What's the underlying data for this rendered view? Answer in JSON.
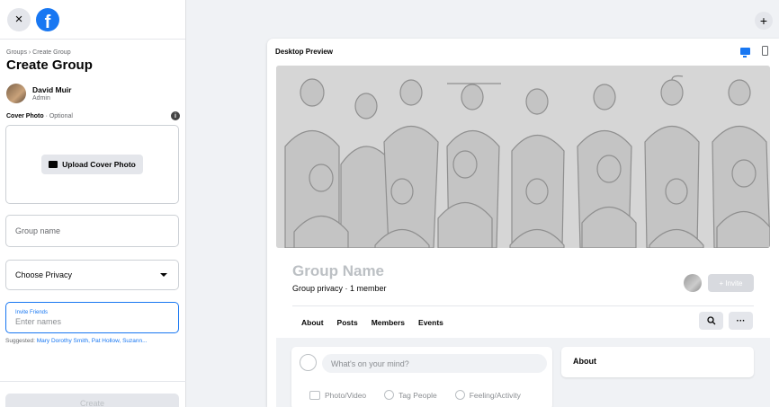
{
  "sidebar": {
    "close_icon": "×",
    "logo_icon": "f",
    "breadcrumb": "Groups › Create Group",
    "title": "Create Group",
    "admin": {
      "name": "David Muir",
      "role": "Admin"
    },
    "cover_label": "Cover Photo",
    "cover_optional": " · Optional",
    "info_icon": "i",
    "upload_label": "Upload Cover Photo",
    "group_name_placeholder": "Group name",
    "privacy_value": "Choose Privacy",
    "invite_label": "Invite Friends",
    "invite_placeholder": "Enter names",
    "suggested_prefix": "Suggested: ",
    "suggested_names": "Mary Dorothy Smith, Pat Hollow, Suzann...",
    "create_label": "Create"
  },
  "top": {
    "plus_icon": "+"
  },
  "preview": {
    "header": "Desktop Preview",
    "group_name": "Group Name",
    "group_meta": "Group privacy · 1 member",
    "invite_label": "+ Invite",
    "tabs": [
      "About",
      "Posts",
      "Members",
      "Events"
    ],
    "search_icon": "🔍",
    "more_icon": "···",
    "composer_placeholder": "What's on your mind?",
    "actions": [
      "Photo/Video",
      "Tag People",
      "Feeling/Activity"
    ],
    "about_title": "About"
  },
  "colors": {
    "accent": "#1877f2",
    "background": "#f0f2f5"
  }
}
